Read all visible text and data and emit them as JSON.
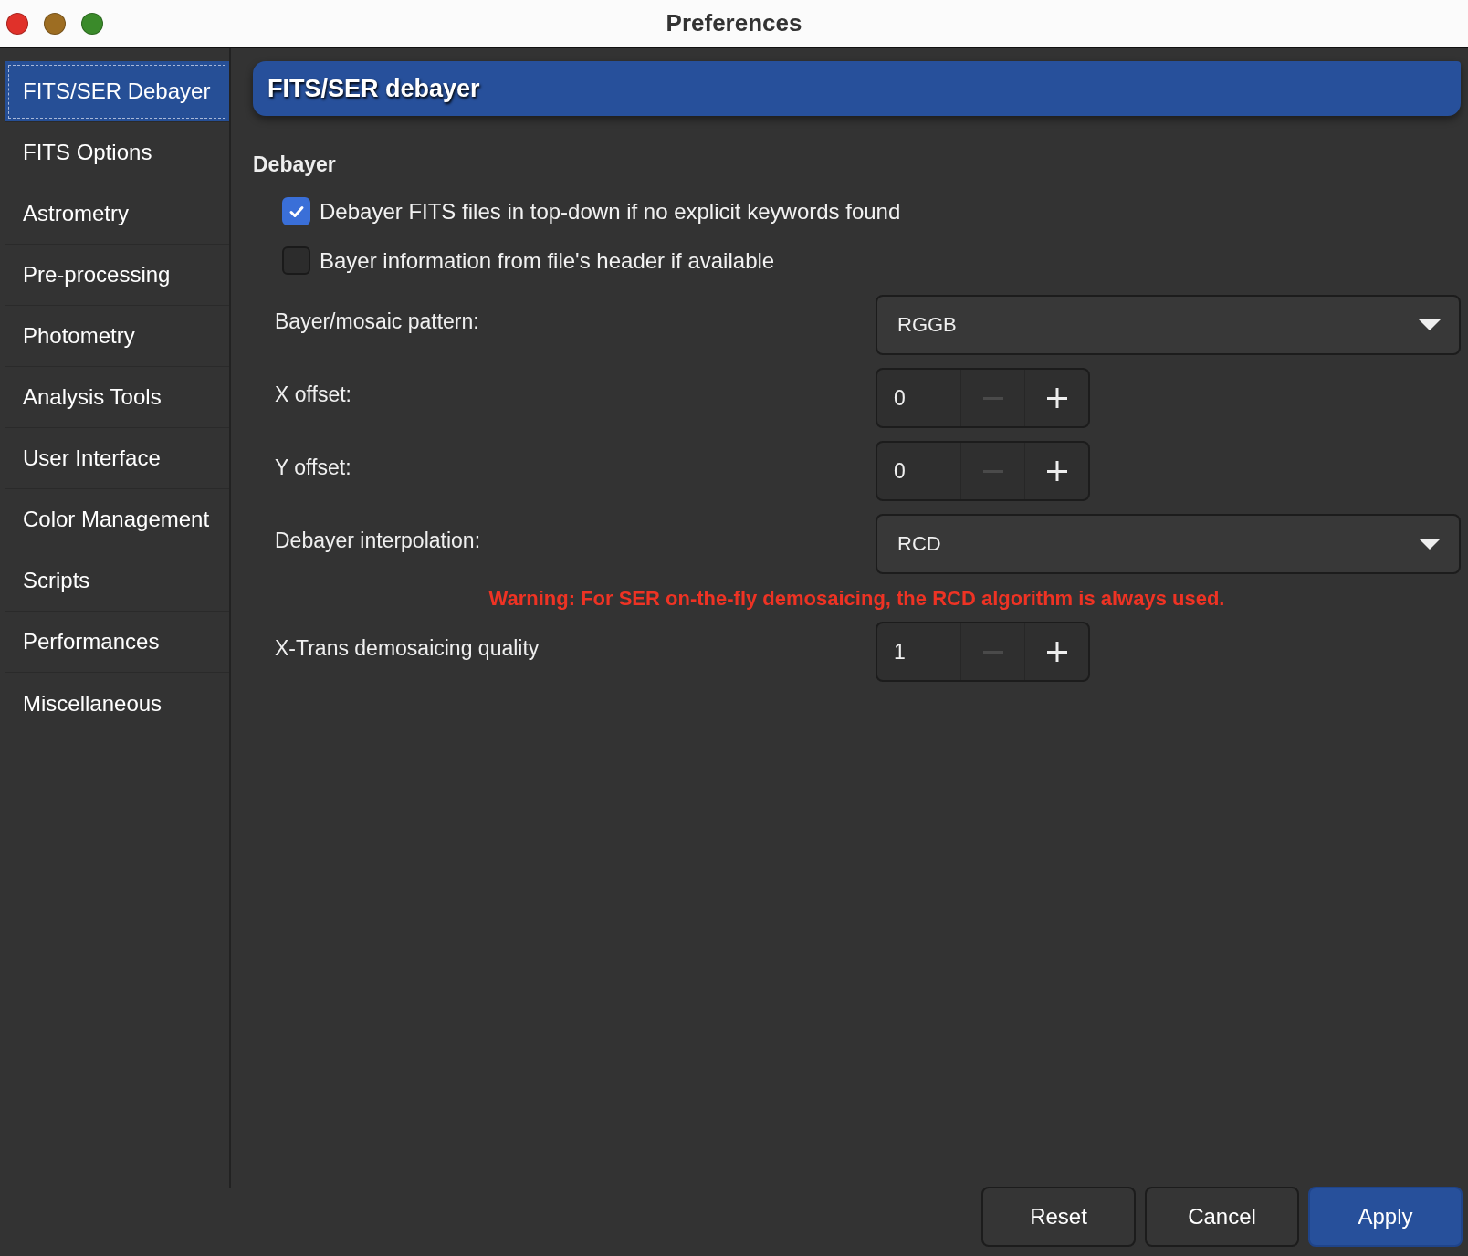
{
  "window": {
    "title": "Preferences"
  },
  "sidebar": {
    "items": [
      {
        "label": "FITS/SER Debayer",
        "selected": true
      },
      {
        "label": "FITS Options",
        "selected": false
      },
      {
        "label": "Astrometry",
        "selected": false
      },
      {
        "label": "Pre-processing",
        "selected": false
      },
      {
        "label": "Photometry",
        "selected": false
      },
      {
        "label": "Analysis Tools",
        "selected": false
      },
      {
        "label": "User Interface",
        "selected": false
      },
      {
        "label": "Color Management",
        "selected": false
      },
      {
        "label": "Scripts",
        "selected": false
      },
      {
        "label": "Performances",
        "selected": false
      },
      {
        "label": "Miscellaneous",
        "selected": false
      }
    ]
  },
  "page": {
    "title": "FITS/SER debayer",
    "section": "Debayer",
    "checkboxes": [
      {
        "label": "Debayer FITS files in top-down if no explicit keywords found",
        "checked": true
      },
      {
        "label": "Bayer information from file's header if available",
        "checked": false
      }
    ],
    "rows": [
      {
        "kind": "combo",
        "label": "Bayer/mosaic pattern:",
        "value": "RGGB"
      },
      {
        "kind": "spin",
        "label": "X offset:",
        "value": "0",
        "decrease_disabled": true
      },
      {
        "kind": "spin",
        "label": "Y offset:",
        "value": "0",
        "decrease_disabled": true
      },
      {
        "kind": "combo",
        "label": "Debayer interpolation:",
        "value": "RCD"
      },
      {
        "kind": "warning",
        "text": "Warning: For SER on-the-fly demosaicing, the RCD algorithm is always used."
      },
      {
        "kind": "spin",
        "label": "X-Trans demosaicing quality",
        "value": "1",
        "decrease_disabled": true
      }
    ]
  },
  "buttons": [
    {
      "label": "Reset",
      "default": false
    },
    {
      "label": "Cancel",
      "default": false
    },
    {
      "label": "Apply",
      "default": true
    }
  ]
}
